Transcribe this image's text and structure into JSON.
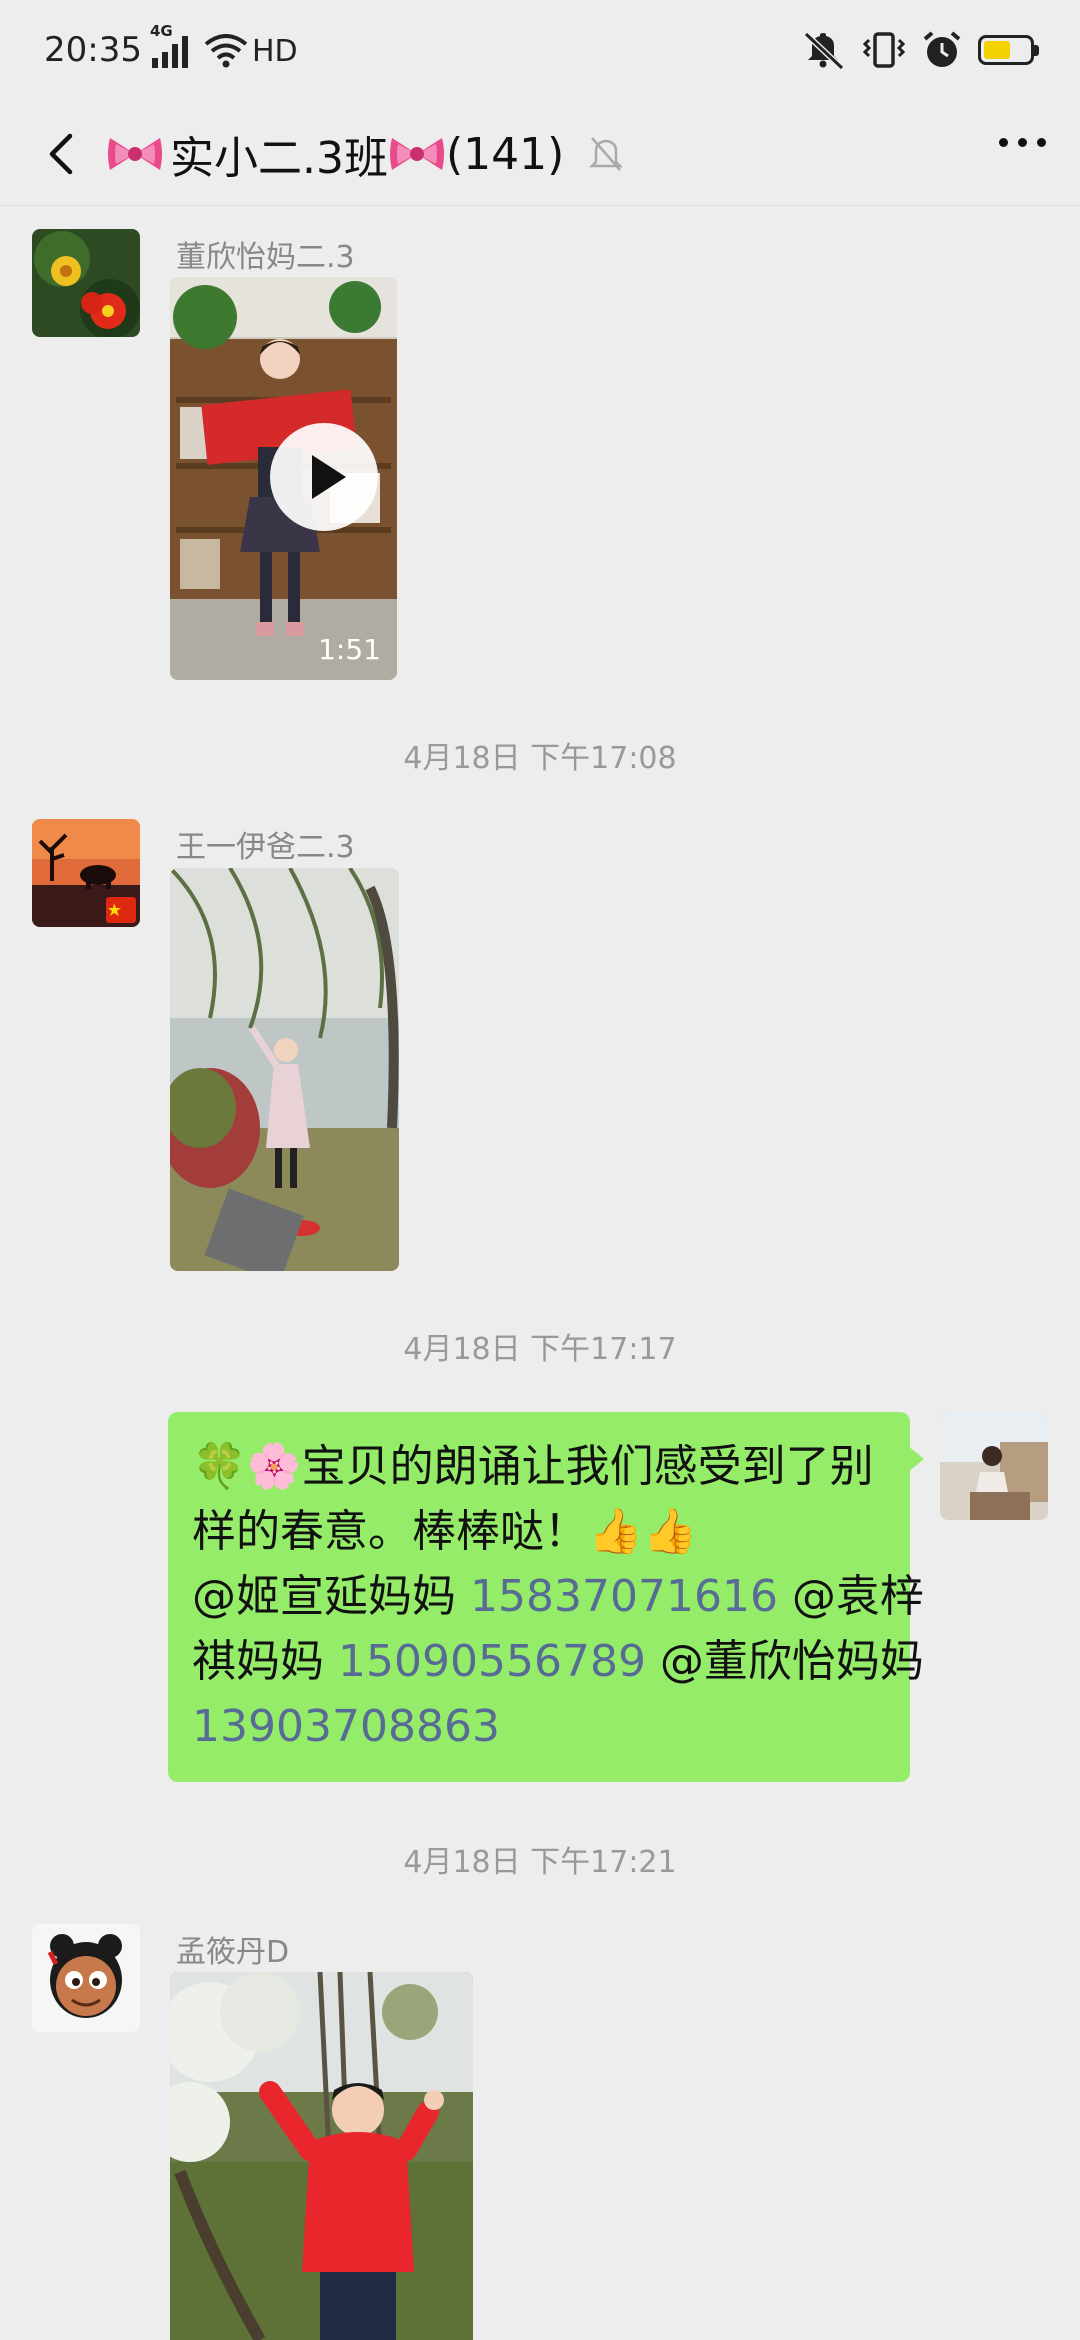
{
  "status_bar": {
    "time": "20:35",
    "network": "4G",
    "hd": "HD",
    "battery_level": 0.6
  },
  "header": {
    "title": "实小二.3班",
    "count": "(141)",
    "back_icon": "chevron-left-icon",
    "more_icon": "more-icon",
    "mute_icon": "bell-slash-icon"
  },
  "messages": [
    {
      "sender": "董欣怡妈二.3",
      "type": "video",
      "duration": "1:51"
    },
    {
      "timestamp": "4月18日 下午17:08"
    },
    {
      "sender": "王一伊爸二.3",
      "type": "image"
    },
    {
      "timestamp": "4月18日 下午17:17"
    },
    {
      "type": "text",
      "self": true,
      "line1": "宝贝的朗诵让我们感受到了别",
      "line2": "样的春意。棒棒哒！",
      "mention1": "@姬宣延妈妈 ",
      "phone1": "15837071616",
      "mention2": " @袁梓",
      "mention2b": "祺妈妈 ",
      "phone2": "15090556789",
      "mention3": " @董欣怡妈妈",
      "phone3": "13903708863"
    },
    {
      "timestamp": "4月18日 下午17:21"
    },
    {
      "sender": "孟筱丹D",
      "type": "image"
    }
  ],
  "colors": {
    "bubble": "#95ec69",
    "background": "#ededed",
    "link": "#576b95"
  }
}
